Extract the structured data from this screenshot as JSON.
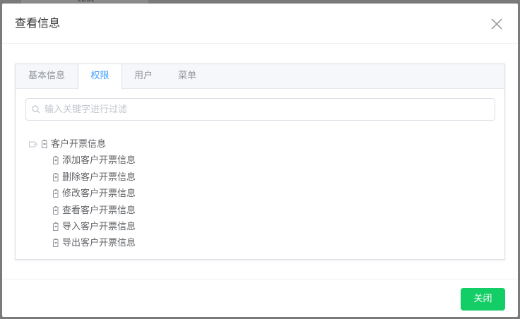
{
  "background": {
    "partial_text": "test"
  },
  "dialog": {
    "title": "查看信息",
    "close_icon": "close-icon"
  },
  "tabs": [
    {
      "label": "基本信息",
      "active": false
    },
    {
      "label": "权限",
      "active": true
    },
    {
      "label": "用户",
      "active": false
    },
    {
      "label": "菜单",
      "active": false
    }
  ],
  "search": {
    "placeholder": "输入关键字进行过滤",
    "value": "",
    "icon": "search-icon"
  },
  "tree": {
    "root": {
      "label": "客户开票信息",
      "expanded": true,
      "expand_icon": "expand-arrow-icon",
      "node_icon": "tag-icon"
    },
    "children": [
      {
        "label": "添加客户开票信息",
        "icon": "tag-icon"
      },
      {
        "label": "删除客户开票信息",
        "icon": "tag-icon"
      },
      {
        "label": "修改客户开票信息",
        "icon": "tag-icon"
      },
      {
        "label": "查看客户开票信息",
        "icon": "tag-icon"
      },
      {
        "label": "导入客户开票信息",
        "icon": "tag-icon"
      },
      {
        "label": "导出客户开票信息",
        "icon": "tag-icon"
      }
    ]
  },
  "footer": {
    "close_label": "关闭"
  },
  "colors": {
    "accent": "#409eff",
    "success": "#13ce66",
    "overlay": "#7a7a7a"
  }
}
